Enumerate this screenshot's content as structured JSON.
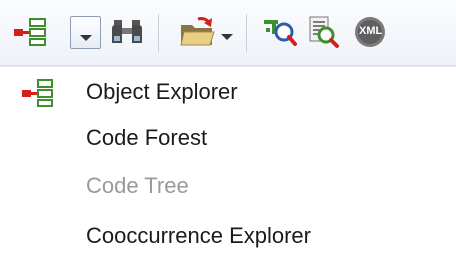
{
  "toolbar": {
    "buttons": [
      {
        "icon": "object-explorer-icon"
      },
      {
        "icon": "chevron-down-icon"
      },
      {
        "icon": "binoculars-icon"
      },
      {
        "icon": "folder-open-icon"
      },
      {
        "icon": "chevron-down-icon"
      },
      {
        "icon": "query-tool-icon"
      },
      {
        "icon": "query-report-icon"
      },
      {
        "icon": "xml-icon",
        "text": "XML"
      }
    ]
  },
  "menu": {
    "items": [
      {
        "label": "Object Explorer",
        "icon": "object-explorer-icon",
        "enabled": true
      },
      {
        "label": "Code Forest",
        "enabled": true
      },
      {
        "label": "Code Tree",
        "enabled": false
      },
      {
        "label": "Cooccurrence Explorer",
        "enabled": true
      }
    ]
  },
  "colors": {
    "accent_red": "#d0221b",
    "icon_green": "#3f8f2e",
    "disabled_text": "#9a9a9a"
  }
}
